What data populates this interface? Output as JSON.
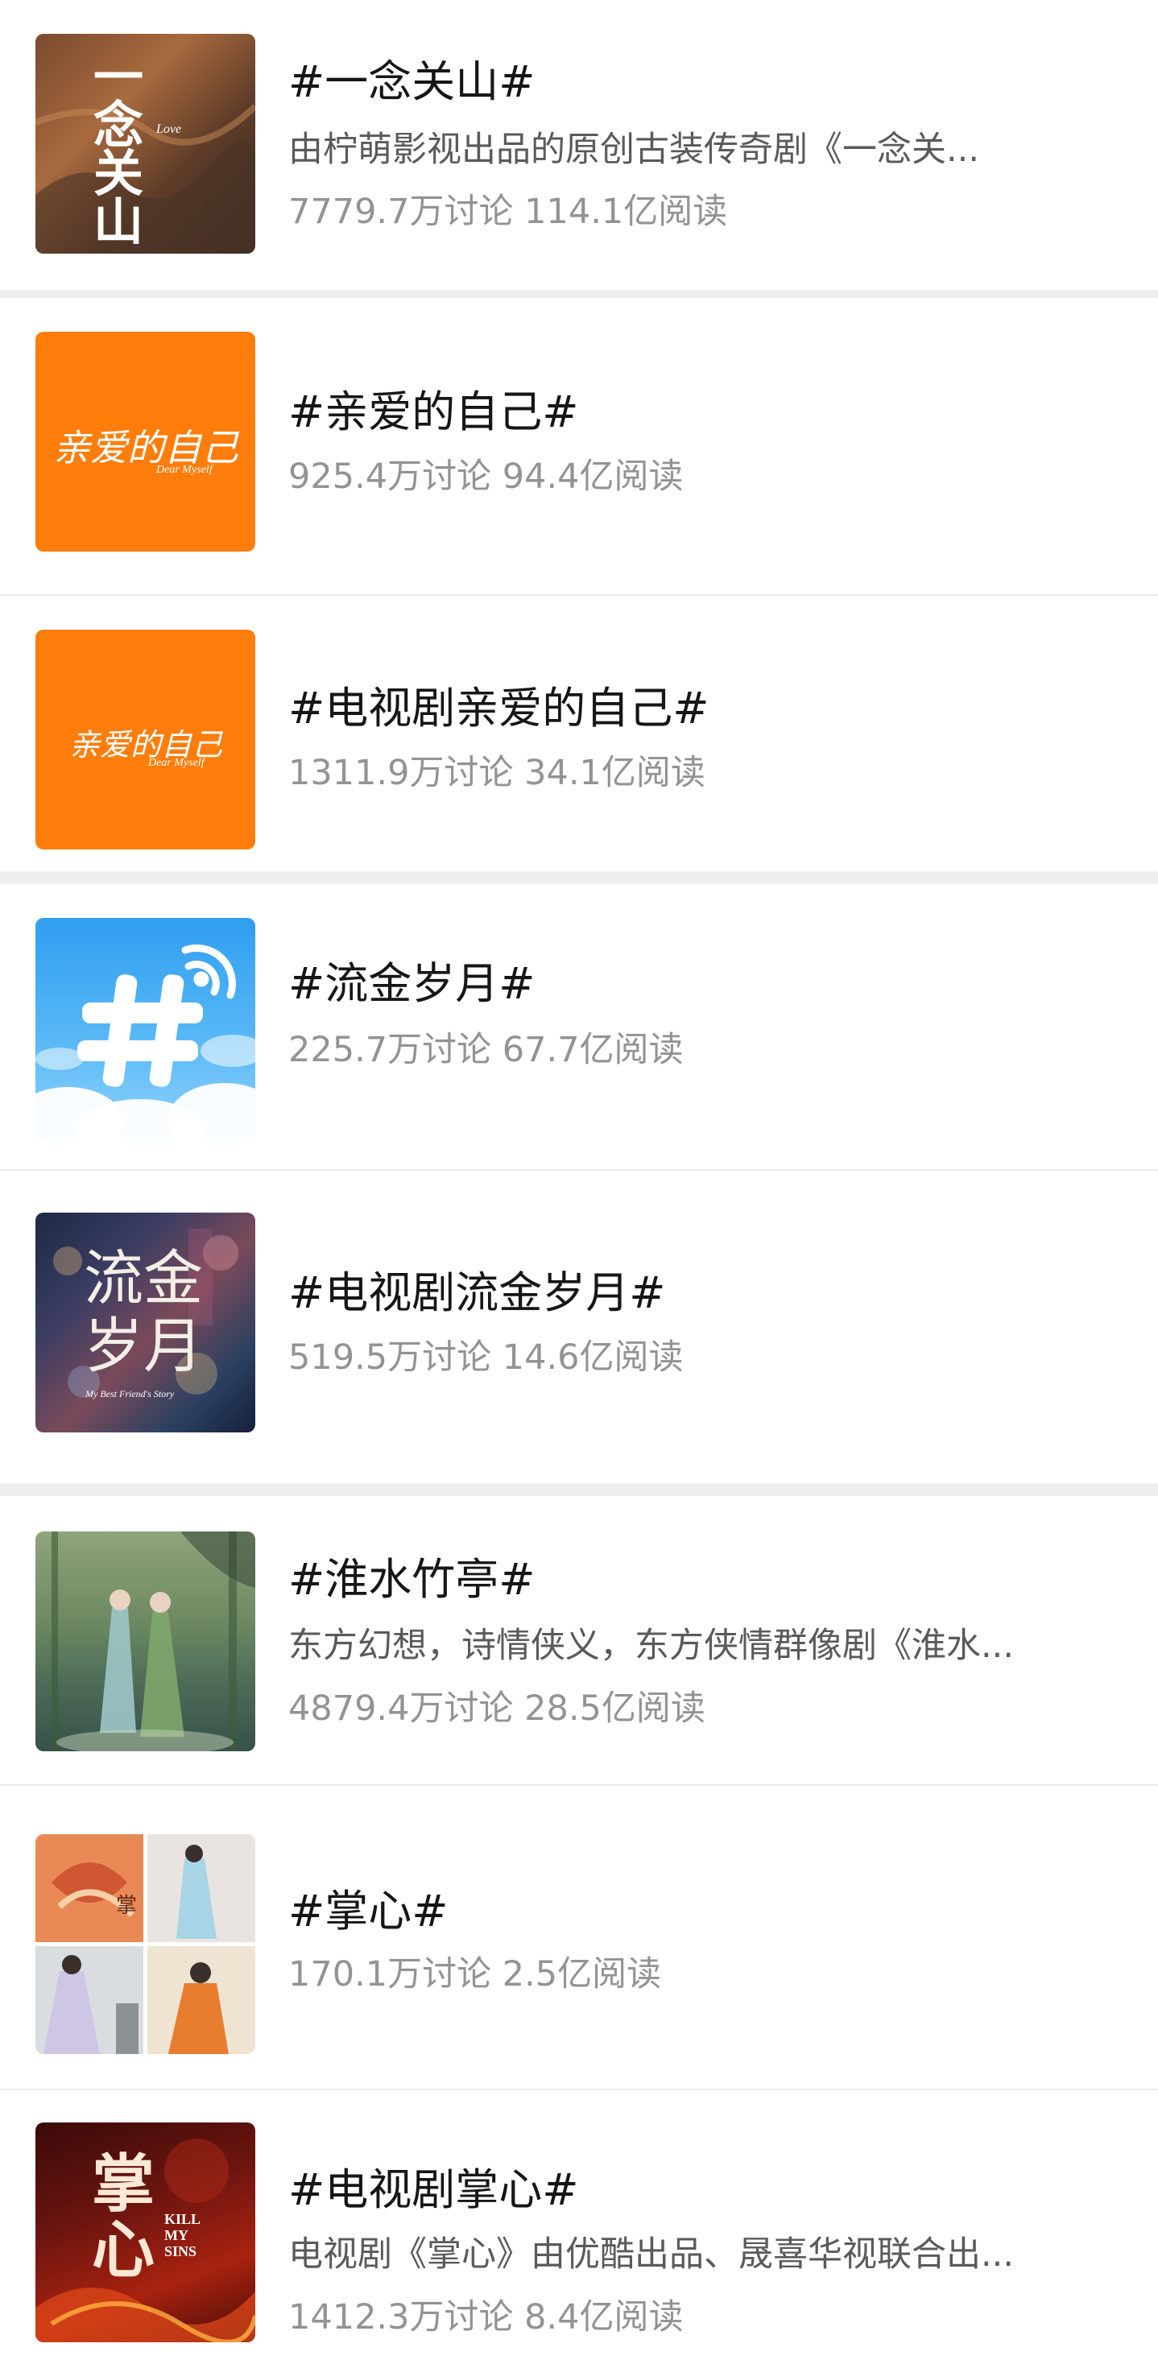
{
  "topics": [
    {
      "title": "#一念关山#",
      "desc": "由柠萌影视出品的原创古装传奇剧《一念关...",
      "stats": "7779.7万讨论 114.1亿阅读",
      "thumb": {
        "icon": "poster-yinian-guanshan",
        "text": "一念关山",
        "sub": "Love"
      }
    },
    {
      "title": "#亲爱的自己#",
      "desc": "",
      "stats": "925.4万讨论 94.4亿阅读",
      "thumb": {
        "icon": "poster-qinai-de-ziji",
        "text": "亲爱的自己",
        "sub": "Dear Myself"
      }
    },
    {
      "title": "#电视剧亲爱的自己#",
      "desc": "",
      "stats": "1311.9万讨论 34.1亿阅读",
      "thumb": {
        "icon": "poster-qinai-de-ziji",
        "text": "亲爱的自己",
        "sub": "Dear Myself"
      }
    },
    {
      "title": "#流金岁月#",
      "desc": "",
      "stats": "225.7万讨论 67.7亿阅读",
      "thumb": {
        "icon": "hashtag-cloud-icon",
        "text": "",
        "sub": ""
      }
    },
    {
      "title": "#电视剧流金岁月#",
      "desc": "",
      "stats": "519.5万讨论 14.6亿阅读",
      "thumb": {
        "icon": "poster-liujin-suiyue",
        "text": "流金岁月",
        "sub": "My Best Friend's Story"
      }
    },
    {
      "title": "#淮水竹亭#",
      "desc": "东方幻想，诗情侠义，东方侠情群像剧《淮水...",
      "stats": "4879.4万讨论 28.5亿阅读",
      "thumb": {
        "icon": "poster-huaishui-zhuting",
        "text": "",
        "sub": ""
      }
    },
    {
      "title": "#掌心#",
      "desc": "",
      "stats": "170.1万讨论 2.5亿阅读",
      "thumb": {
        "icon": "poster-zhangxin-collage",
        "text": "掌",
        "sub": ""
      }
    },
    {
      "title": "#电视剧掌心#",
      "desc": "电视剧《掌心》由优酷出品、晟喜华视联合出...",
      "stats": "1412.3万讨论 8.4亿阅读",
      "thumb": {
        "icon": "poster-zhangxin",
        "text": "掌心",
        "sub": "KILL MY SINS"
      }
    }
  ],
  "colors": {
    "orange": "#ff7d0b",
    "stats_gray": "#939393",
    "desc_gray": "#5a5a5a",
    "separator": "#efefef"
  }
}
